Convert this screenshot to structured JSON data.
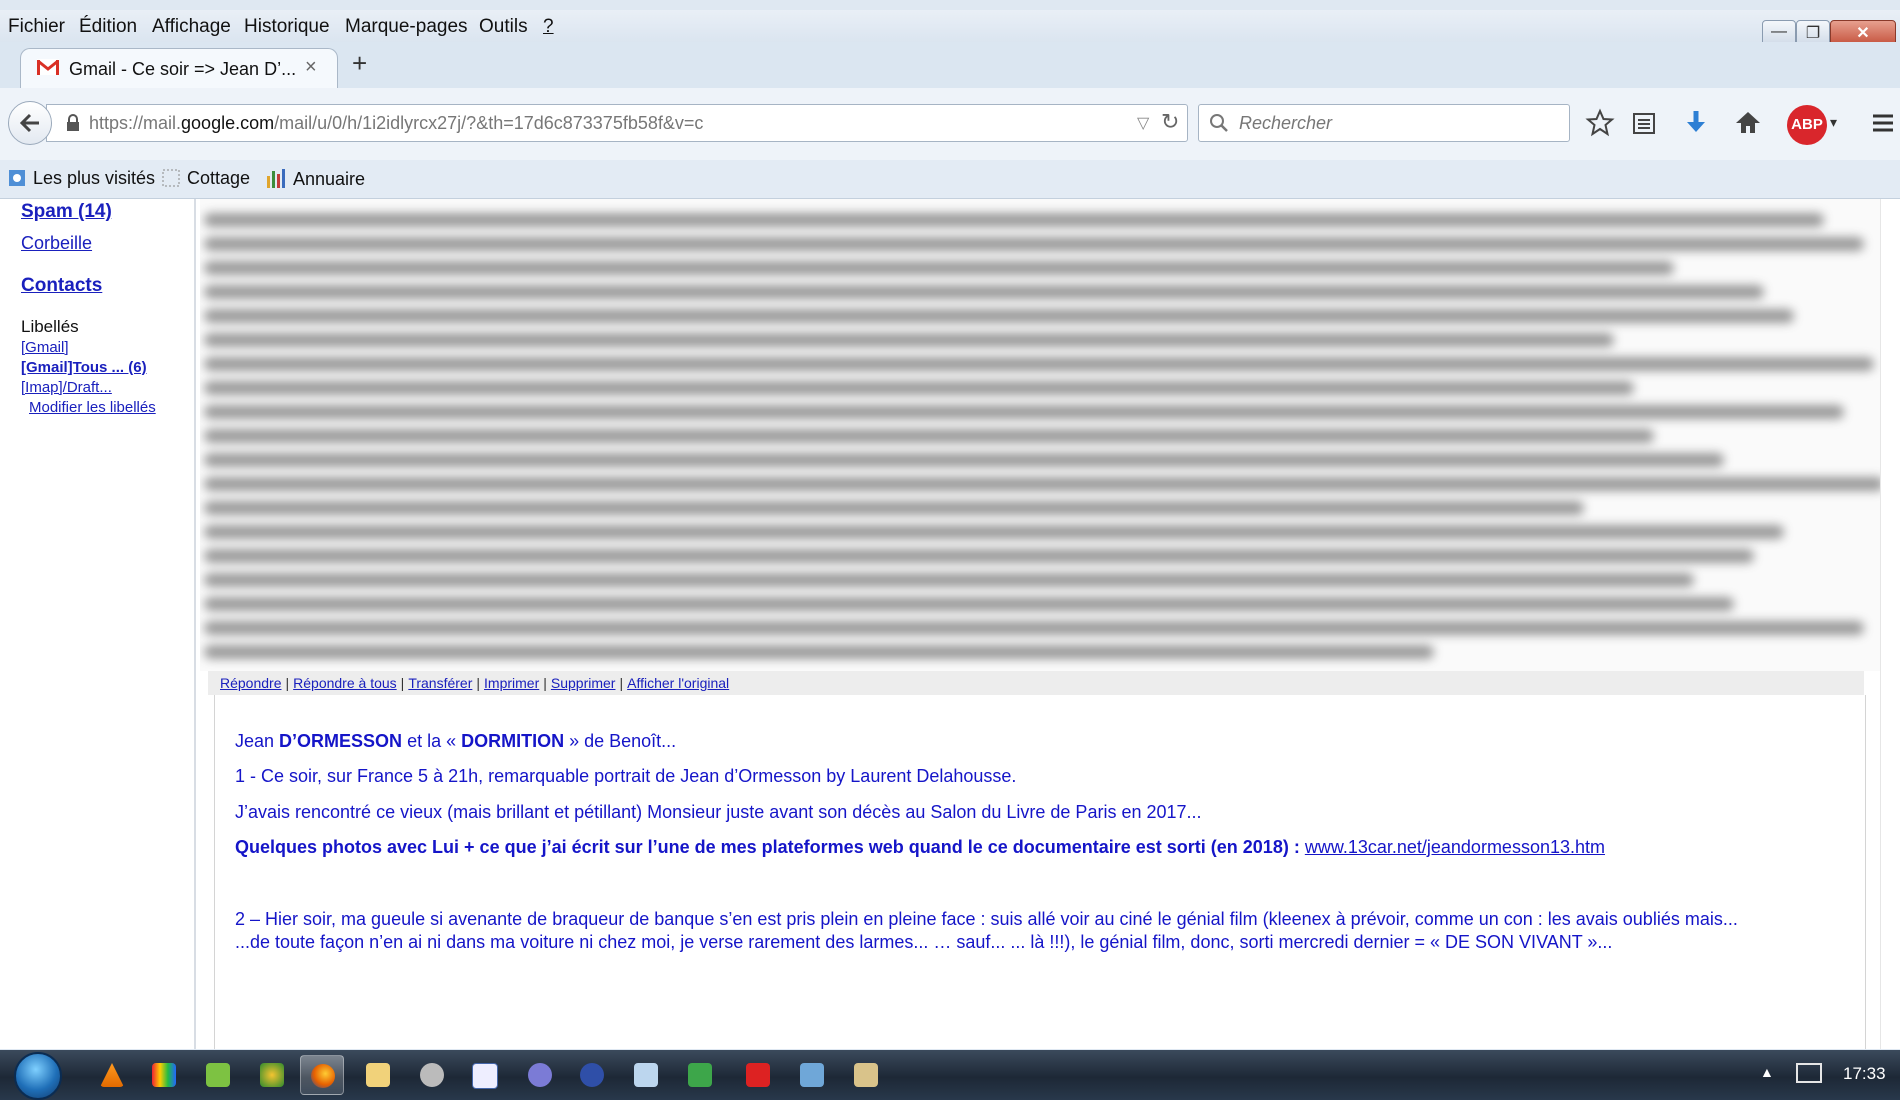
{
  "menubar": {
    "items": [
      "Fichier",
      "Édition",
      "Affichage",
      "Historique",
      "Marque-pages",
      "Outils",
      "?"
    ]
  },
  "tab": {
    "title": "Gmail - Ce soir => Jean D’...",
    "close": "×",
    "new_tab": "+"
  },
  "window_buttons": {
    "minimize": "—",
    "maximize": "❐",
    "close": "✕"
  },
  "navbar": {
    "url_prefix": "https://mail.",
    "url_domain": "google.com",
    "url_rest": "/mail/u/0/h/1i2idlyrcx27j/?&th=17d6c873375fb58f&v=c",
    "search_placeholder": "Rechercher",
    "abp_label": "ABP"
  },
  "bookmarks": [
    "Les plus visités",
    "Cottage",
    "Annuaire"
  ],
  "sidebar": {
    "spam": "Spam (14)",
    "trash": "Corbeille",
    "contacts": "Contacts",
    "labels_heading": "Libellés",
    "labels": [
      "[Gmail]",
      "[Gmail]Tous ... (6)",
      "[Imap]/Draft..."
    ],
    "edit_labels": "Modifier les libellés"
  },
  "actions": [
    "Répondre",
    "Répondre à tous",
    "Transférer",
    "Imprimer",
    "Supprimer",
    "Afficher l'original"
  ],
  "email": {
    "line1_a": "Jean ",
    "line1_b": "D’ORMESSON",
    "line1_c": " et la « ",
    "line1_d": "DORMITION",
    "line1_e": " » de Benoît...",
    "line2": "1 - Ce soir, sur France 5 à 21h, remarquable portrait de Jean d’Ormesson by Laurent Delahousse.",
    "line3": "J’avais rencontré ce vieux (mais brillant et pétillant) Monsieur juste avant son décès au Salon du Livre de Paris en 2017...",
    "line4": "Quelques photos avec Lui + ce que j’ai écrit sur l’une de mes plateformes web quand le ce documentaire est sorti (en 2018) : ",
    "link": "www.13car.net/jeandormesson13.htm",
    "line5": "2 – Hier soir, ma gueule si avenante de braqueur de banque s’en est pris plein en pleine face : suis allé voir au ciné le génial film (kleenex à prévoir, comme un con : les avais oubliés mais...",
    "line6": "...de toute façon n’en ai ni dans ma voiture ni chez moi, je verse rarement des larmes... … sauf... ... là !!!), le génial film, donc, sorti mercredi dernier = « DE SON VIVANT »..."
  },
  "taskbar": {
    "clock": "17:33",
    "tray_arrow": "▲"
  },
  "colors": {
    "link_blue": "#1a20bd",
    "mail_text_blue": "#1515c8",
    "label_green": "#0b6b31",
    "abp_red": "#d9262c"
  }
}
